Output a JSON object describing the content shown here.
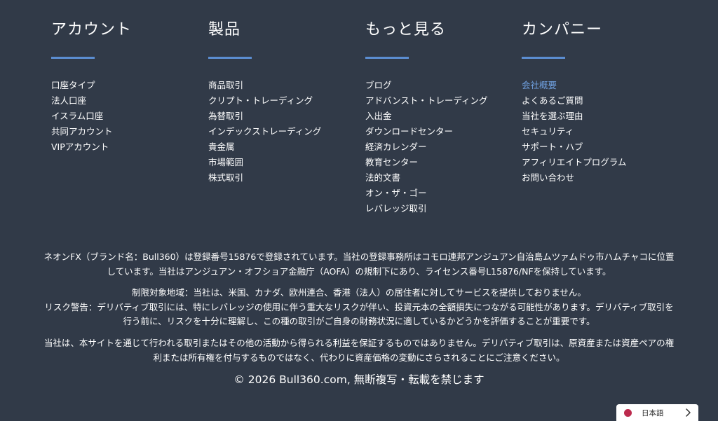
{
  "footer": {
    "columns": [
      {
        "title": "アカウント",
        "items": [
          "口座タイプ",
          "法人口座",
          "イスラム口座",
          "共同アカウント",
          "VIPアカウント"
        ]
      },
      {
        "title": "製品",
        "items": [
          "商品取引",
          "クリプト・トレーディング",
          "為替取引",
          "インデックストレーディング",
          "貴金属",
          "市場範囲",
          "株式取引"
        ]
      },
      {
        "title": "もっと見る",
        "items": [
          "ブログ",
          "アドバンスト・トレーディング",
          "入出金",
          "ダウンロードセンター",
          "経済カレンダー",
          "教育センター",
          "法的文書",
          "オン・ザ・ゴー",
          "レバレッジ取引"
        ]
      },
      {
        "title": "カンパニー",
        "items": [
          "会社概要",
          "よくあるご質問",
          "当社を選ぶ理由",
          "セキュリティ",
          "サポート・ハブ",
          "アフィリエイトプログラム",
          "お問い合わせ"
        ],
        "active_item": "会社概要"
      }
    ],
    "accent_color": "#5b8dd1",
    "active_link_color": "#6fa0e0",
    "background_color": "#313a48"
  },
  "legal": {
    "registration": "ネオンFX（ブランド名：Bull360）は登録番号15876で登録されています。当社の登録事務所はコモロ連邦アンジュアン自治島ムツァムドゥ市ハムチャコに位置しています。当社はアンジュアン・オフショア金融庁（AOFA）の規制下にあり、ライセンス番号L15876/NFを保持しています。",
    "restricted": "制限対象地域：当社は、米国、カナダ、欧州連合、香港（法人）の居住者に対してサービスを提供しておりません。",
    "risk": "リスク警告：デリバティブ取引には、特にレバレッジの使用に伴う重大なリスクが伴い、投資元本の全額損失につながる可能性があります。デリバティブ取引を行う前に、リスクを十分に理解し、この種の取引がご自身の財務状況に適しているかどうかを評価することが重要です。",
    "disclaimer": "当社は、本サイトを通じて行われる取引またはその他の活動から得られる利益を保証するものではありません。デリバティブ取引は、原資産または資産ペアの権利または所有権を付与するものではなく、代わりに資産価格の変動にさらされることにご注意ください。",
    "copyright": "© 2026 Bull360.com, 無断複写・転載を禁じます"
  },
  "language_selector": {
    "label": "日本語",
    "flag_icon": "japan-flag-icon",
    "chevron_icon": "chevron-right-icon",
    "flag_color": "#bc2a4d"
  }
}
